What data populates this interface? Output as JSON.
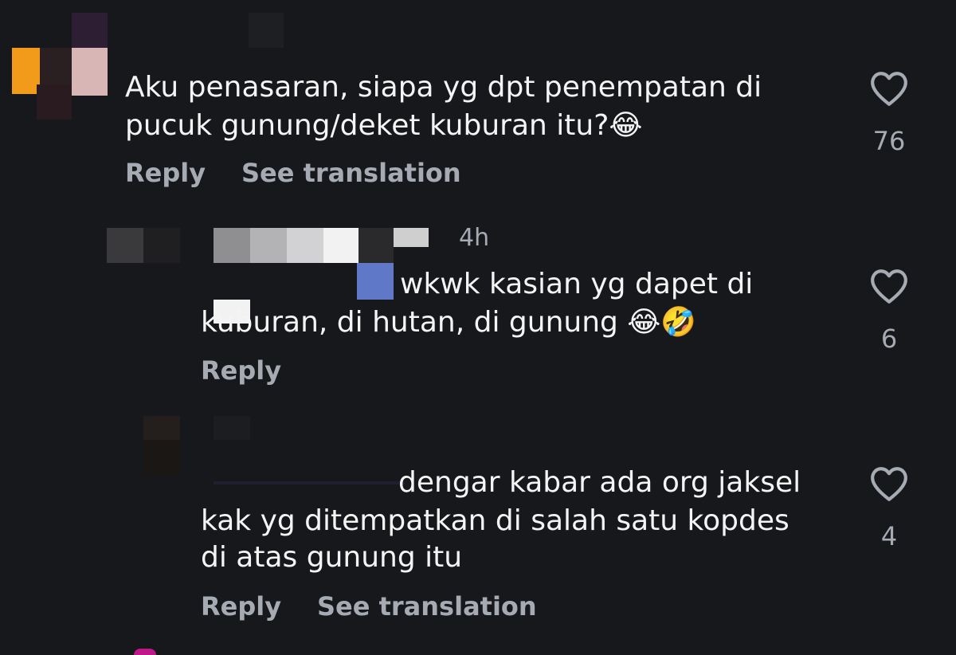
{
  "comments": [
    {
      "lines": [
        "Aku penasaran, siapa yg dpt penempatan di",
        "pucuk gunung/deket kuburan itu?😂"
      ],
      "likes": "76",
      "reply_label": "Reply",
      "translate_label": "See translation"
    },
    {
      "time": "4h",
      "lines": [
        "wkwk kasian yg dapet di",
        "kuburan, di hutan, di gunung 😂🤣"
      ],
      "likes": "6",
      "reply_label": "Reply"
    },
    {
      "lines": [
        "dengar kabar ada org jaksel",
        "kak yg ditempatkan di salah satu kopdes",
        "di atas gunung itu"
      ],
      "likes": "4",
      "reply_label": "Reply",
      "translate_label": "See translation"
    }
  ],
  "icons": {
    "like": "heart-outline-icon"
  },
  "colors": {
    "background": "#16181c",
    "text": "#f4f4f4",
    "secondary": "#a6abb3"
  }
}
